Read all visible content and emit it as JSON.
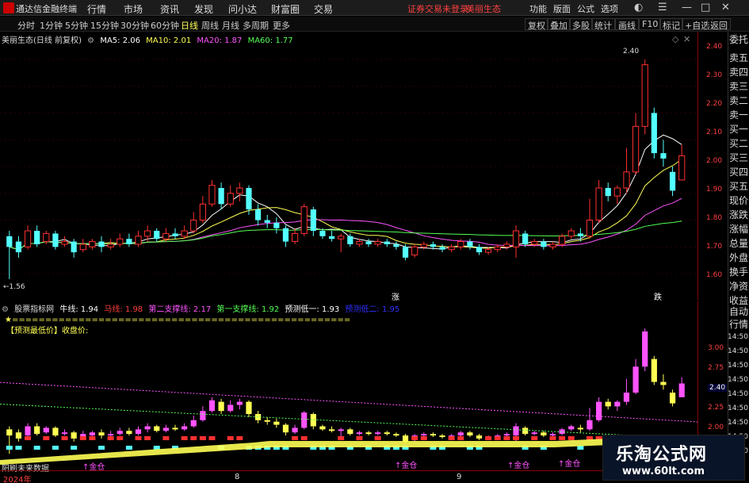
{
  "topbar": {
    "app_name": "通达信金融终端",
    "menu": [
      "行情",
      "市场",
      "资讯",
      "发现",
      "问小达",
      "财富圈",
      "交易"
    ],
    "status": [
      "证券交易未登录",
      "美丽生态"
    ],
    "right": [
      "功能",
      "版面",
      "公式",
      "选项"
    ]
  },
  "toolbar": {
    "periods": [
      "分时",
      "1分钟",
      "5分钟",
      "15分钟",
      "30分钟",
      "60分钟",
      "日线",
      "周线",
      "月线",
      "多周期",
      "更多"
    ],
    "active_period": "日线",
    "right_buttons": [
      "复权",
      "叠加",
      "多股",
      "统计",
      "画线",
      "F10",
      "标记",
      "+自选",
      "返回"
    ]
  },
  "main": {
    "title": "美丽生态(日线 前复权)",
    "ma": [
      {
        "label": "MA5: 2.06",
        "color": "#ffffff"
      },
      {
        "label": "MA10: 2.01",
        "color": "#ffff54"
      },
      {
        "label": "MA20: 1.87",
        "color": "#ff54ff"
      },
      {
        "label": "MA60: 1.77",
        "color": "#54ff54"
      }
    ],
    "high_label": "2.40",
    "low_label": "←1.56",
    "price_ticks": [
      "2.40",
      "2.30",
      "2.20",
      "2.10",
      "2.00",
      "1.90",
      "1.80",
      "1.70",
      "1.60"
    ],
    "markers": [
      "涨",
      "跌"
    ]
  },
  "right_panel": [
    "委托",
    "卖五",
    "卖四",
    "卖三",
    "卖二",
    "卖一",
    "买一",
    "买二",
    "买三",
    "买四",
    "买五",
    "现价",
    "涨跌",
    "涨幅",
    "总量",
    "外盘",
    "换手",
    "净资",
    "收益",
    "自动",
    "行情"
  ],
  "sub": {
    "title": "股票指标网",
    "items": [
      {
        "label": "牛线: 1.94",
        "color": "#ffffff"
      },
      {
        "label": "马线: 1.98",
        "color": "#ff4040"
      },
      {
        "label": "第二支撑线: 2.17",
        "color": "#ff54ff"
      },
      {
        "label": "第一支撑线: 1.92",
        "color": "#54ff54"
      },
      {
        "label": "预测低一: 1.93",
        "color": "#ffffff"
      },
      {
        "label": "预测低二: 1.95",
        "color": "#3030ff"
      }
    ],
    "star_line": "★===================================================",
    "label": "【预测最低价】收盘价:",
    "axis_values": [
      "3.00",
      "2.75",
      "2.50",
      "2.25",
      "2.00"
    ],
    "current_price": "2.40",
    "time_labels": [
      "14:50",
      "14:50",
      "14:50",
      "14:50",
      "14:50",
      "14:50",
      "14:50",
      "14:50",
      "14:50"
    ],
    "buy_labels": [
      "↑金仓",
      "↑金仓",
      "↑金仓",
      "↑金仓"
    ],
    "predict_label": "阳刷未来数据"
  },
  "date_axis": [
    "2024年",
    "8",
    "9"
  ],
  "watermark": {
    "cn": "乐淘公式网",
    "url": "www.60lt.com"
  },
  "chart_data": {
    "type": "candlestick",
    "title": "美丽生态(日线 前复权)",
    "ylim": [
      1.55,
      2.45
    ],
    "candles": [
      [
        1.74,
        1.7,
        1.76,
        1.58
      ],
      [
        1.72,
        1.68,
        1.74,
        1.66
      ],
      [
        1.7,
        1.76,
        1.78,
        1.69
      ],
      [
        1.76,
        1.71,
        1.78,
        1.7
      ],
      [
        1.72,
        1.75,
        1.76,
        1.71
      ],
      [
        1.75,
        1.7,
        1.76,
        1.69
      ],
      [
        1.71,
        1.72,
        1.74,
        1.7
      ],
      [
        1.72,
        1.68,
        1.73,
        1.66
      ],
      [
        1.69,
        1.71,
        1.73,
        1.68
      ],
      [
        1.7,
        1.72,
        1.73,
        1.69
      ],
      [
        1.72,
        1.7,
        1.74,
        1.68
      ],
      [
        1.7,
        1.71,
        1.73,
        1.69
      ],
      [
        1.71,
        1.73,
        1.75,
        1.7
      ],
      [
        1.73,
        1.71,
        1.75,
        1.7
      ],
      [
        1.71,
        1.74,
        1.76,
        1.7
      ],
      [
        1.74,
        1.76,
        1.78,
        1.72
      ],
      [
        1.76,
        1.73,
        1.77,
        1.72
      ],
      [
        1.73,
        1.75,
        1.77,
        1.72
      ],
      [
        1.75,
        1.74,
        1.77,
        1.73
      ],
      [
        1.74,
        1.76,
        1.78,
        1.73
      ],
      [
        1.76,
        1.8,
        1.83,
        1.75
      ],
      [
        1.8,
        1.86,
        1.89,
        1.79
      ],
      [
        1.86,
        1.93,
        1.95,
        1.85
      ],
      [
        1.92,
        1.86,
        1.94,
        1.84
      ],
      [
        1.86,
        1.9,
        1.93,
        1.85
      ],
      [
        1.9,
        1.92,
        1.94,
        1.87
      ],
      [
        1.92,
        1.84,
        1.93,
        1.82
      ],
      [
        1.84,
        1.8,
        1.86,
        1.78
      ],
      [
        1.8,
        1.79,
        1.82,
        1.77
      ],
      [
        1.79,
        1.77,
        1.81,
        1.75
      ],
      [
        1.77,
        1.72,
        1.78,
        1.7
      ],
      [
        1.72,
        1.75,
        1.77,
        1.71
      ],
      [
        1.75,
        1.85,
        1.86,
        1.74
      ],
      [
        1.84,
        1.76,
        1.85,
        1.74
      ],
      [
        1.76,
        1.74,
        1.77,
        1.73
      ],
      [
        1.74,
        1.73,
        1.76,
        1.72
      ],
      [
        1.73,
        1.74,
        1.75,
        1.68
      ],
      [
        1.74,
        1.71,
        1.75,
        1.7
      ],
      [
        1.71,
        1.72,
        1.73,
        1.7
      ],
      [
        1.72,
        1.71,
        1.73,
        1.7
      ],
      [
        1.71,
        1.72,
        1.73,
        1.7
      ],
      [
        1.72,
        1.71,
        1.73,
        1.7
      ],
      [
        1.71,
        1.7,
        1.72,
        1.69
      ],
      [
        1.7,
        1.66,
        1.71,
        1.65
      ],
      [
        1.67,
        1.7,
        1.71,
        1.66
      ],
      [
        1.7,
        1.71,
        1.72,
        1.69
      ],
      [
        1.71,
        1.7,
        1.72,
        1.69
      ],
      [
        1.7,
        1.69,
        1.71,
        1.68
      ],
      [
        1.69,
        1.7,
        1.71,
        1.68
      ],
      [
        1.7,
        1.72,
        1.73,
        1.69
      ],
      [
        1.72,
        1.7,
        1.73,
        1.69
      ],
      [
        1.7,
        1.68,
        1.71,
        1.67
      ],
      [
        1.68,
        1.69,
        1.7,
        1.67
      ],
      [
        1.69,
        1.7,
        1.71,
        1.68
      ],
      [
        1.7,
        1.71,
        1.72,
        1.69
      ],
      [
        1.7,
        1.76,
        1.78,
        1.66
      ],
      [
        1.75,
        1.71,
        1.76,
        1.7
      ],
      [
        1.71,
        1.72,
        1.73,
        1.7
      ],
      [
        1.72,
        1.7,
        1.73,
        1.69
      ],
      [
        1.7,
        1.71,
        1.72,
        1.69
      ],
      [
        1.71,
        1.74,
        1.75,
        1.7
      ],
      [
        1.74,
        1.76,
        1.77,
        1.73
      ],
      [
        1.75,
        1.74,
        1.77,
        1.72
      ],
      [
        1.74,
        1.8,
        1.88,
        1.73
      ],
      [
        1.8,
        1.92,
        1.95,
        1.79
      ],
      [
        1.92,
        1.89,
        1.94,
        1.87
      ],
      [
        1.89,
        1.92,
        1.93,
        1.86
      ],
      [
        1.92,
        1.98,
        2.07,
        1.9
      ],
      [
        1.98,
        2.15,
        2.2,
        1.97
      ],
      [
        2.15,
        2.38,
        2.4,
        2.12
      ],
      [
        2.2,
        2.05,
        2.22,
        2.03
      ],
      [
        2.05,
        2.03,
        2.1,
        2.0
      ],
      [
        1.98,
        1.91,
        2.0,
        1.89
      ],
      [
        1.95,
        2.04,
        2.08,
        1.96
      ]
    ]
  }
}
